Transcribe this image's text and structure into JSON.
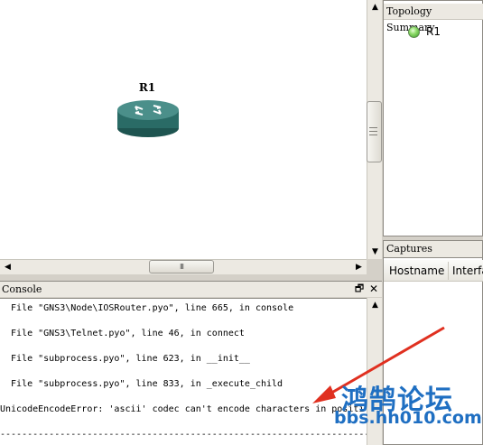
{
  "canvas": {
    "router": {
      "label": "R1"
    }
  },
  "scrollbars": {
    "up_arrow": "▲",
    "down_arrow": "▼",
    "left_arrow": "◀",
    "right_arrow": "▶",
    "h_grip": "III"
  },
  "topology_summary": {
    "title": "Topology Summary",
    "items": [
      {
        "label": "R1",
        "status": "started",
        "status_color": "#5fc23f"
      }
    ]
  },
  "captures": {
    "title": "Captures",
    "columns": [
      "Hostname",
      "Interfa"
    ]
  },
  "console": {
    "title": "Console",
    "float_icon": "🗗",
    "close_icon": "✕",
    "lines": [
      "  File \"GNS3\\Node\\IOSRouter.pyo\", line 665, in console",
      "  File \"GNS3\\Telnet.pyo\", line 46, in connect",
      "  File \"subprocess.pyo\", line 623, in __init__",
      "  File \"subprocess.pyo\", line 833, in _execute_child",
      "UnicodeEncodeError: 'ascii' codec can't encode characters in positi",
      "--------------------------------------------------------------------"
    ]
  },
  "watermark": {
    "chinese": "鸿鹄论坛",
    "url": "bbs.hh010.com",
    "color": "#1f6fc2"
  },
  "annotation": {
    "arrow_color": "#e03020"
  }
}
